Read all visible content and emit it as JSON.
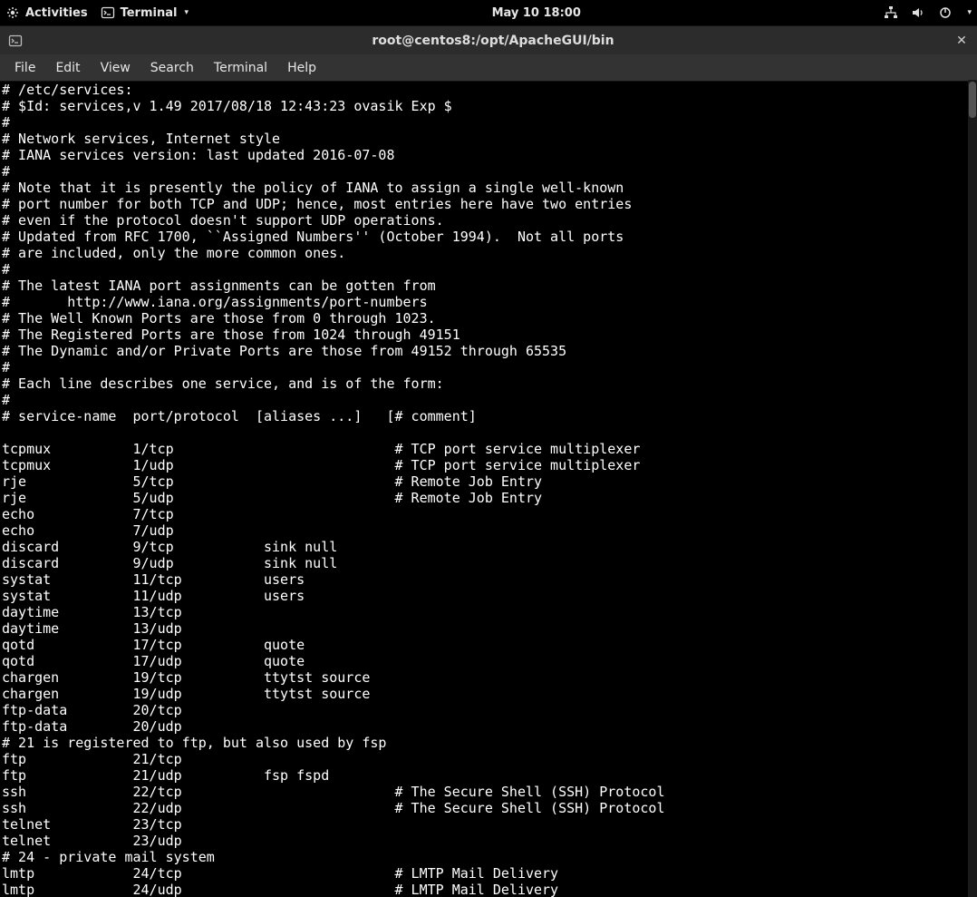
{
  "topbar": {
    "activities": "Activities",
    "terminal": "Terminal",
    "clock": "May 10  18:00"
  },
  "window": {
    "title": "root@centos8:/opt/ApacheGUI/bin"
  },
  "menu": {
    "items": [
      "File",
      "Edit",
      "View",
      "Search",
      "Terminal",
      "Help"
    ]
  },
  "terminal": {
    "lines": [
      "# /etc/services:",
      "# $Id: services,v 1.49 2017/08/18 12:43:23 ovasik Exp $",
      "#",
      "# Network services, Internet style",
      "# IANA services version: last updated 2016-07-08",
      "#",
      "# Note that it is presently the policy of IANA to assign a single well-known",
      "# port number for both TCP and UDP; hence, most entries here have two entries",
      "# even if the protocol doesn't support UDP operations.",
      "# Updated from RFC 1700, ``Assigned Numbers'' (October 1994).  Not all ports",
      "# are included, only the more common ones.",
      "#",
      "# The latest IANA port assignments can be gotten from",
      "#       http://www.iana.org/assignments/port-numbers",
      "# The Well Known Ports are those from 0 through 1023.",
      "# The Registered Ports are those from 1024 through 49151",
      "# The Dynamic and/or Private Ports are those from 49152 through 65535",
      "#",
      "# Each line describes one service, and is of the form:",
      "#",
      "# service-name  port/protocol  [aliases ...]   [# comment]",
      "",
      "tcpmux          1/tcp                           # TCP port service multiplexer",
      "tcpmux          1/udp                           # TCP port service multiplexer",
      "rje             5/tcp                           # Remote Job Entry",
      "rje             5/udp                           # Remote Job Entry",
      "echo            7/tcp",
      "echo            7/udp",
      "discard         9/tcp           sink null",
      "discard         9/udp           sink null",
      "systat          11/tcp          users",
      "systat          11/udp          users",
      "daytime         13/tcp",
      "daytime         13/udp",
      "qotd            17/tcp          quote",
      "qotd            17/udp          quote",
      "chargen         19/tcp          ttytst source",
      "chargen         19/udp          ttytst source",
      "ftp-data        20/tcp",
      "ftp-data        20/udp",
      "# 21 is registered to ftp, but also used by fsp",
      "ftp             21/tcp",
      "ftp             21/udp          fsp fspd",
      "ssh             22/tcp                          # The Secure Shell (SSH) Protocol",
      "ssh             22/udp                          # The Secure Shell (SSH) Protocol",
      "telnet          23/tcp",
      "telnet          23/udp",
      "# 24 - private mail system",
      "lmtp            24/tcp                          # LMTP Mail Delivery",
      "lmtp            24/udp                          # LMTP Mail Delivery"
    ]
  }
}
